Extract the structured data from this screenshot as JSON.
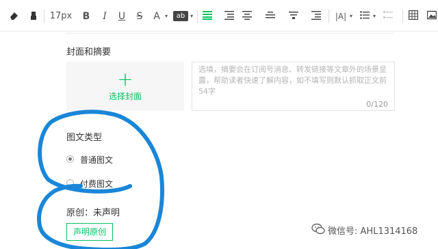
{
  "toolbar": {
    "font_size": "17px",
    "bold_glyph": "B",
    "italic_glyph": "I",
    "underline_glyph": "U",
    "strike_glyph": "S",
    "font_color_glyph": "A",
    "highlight_glyph": "ab"
  },
  "cover": {
    "section_title": "封面和摘要",
    "plus_glyph": "+",
    "select_cover_label": "选择封面"
  },
  "summary": {
    "placeholder": "选填，摘要会在订阅号消息、转发链接等文章外的场景显露，帮助读者快速了解内容，如不填写则默认抓取正文前54字",
    "counter": "0/120"
  },
  "article_type": {
    "title": "图文类型",
    "options": [
      {
        "label": "普通图文",
        "checked": true
      },
      {
        "label": "付费图文",
        "checked": false
      }
    ]
  },
  "original": {
    "status_text": "原创：未声明",
    "declare_button": "声明原创"
  },
  "watermark": {
    "text": "微信号: AHL1314168"
  },
  "colors": {
    "accent_green": "#07c160",
    "scribble_blue": "#1a86d8"
  }
}
